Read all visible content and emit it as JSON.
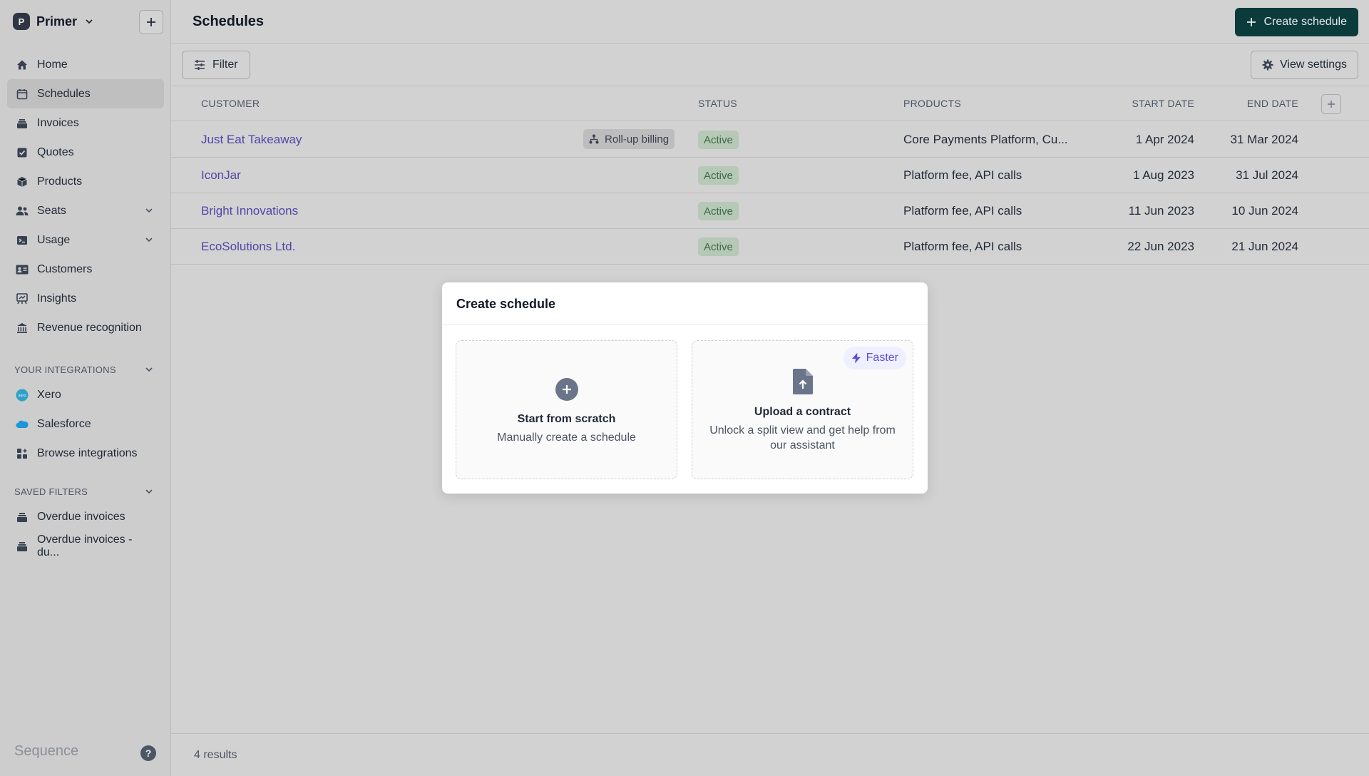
{
  "workspace": {
    "initial": "P",
    "name": "Primer"
  },
  "sidebar": {
    "items": [
      {
        "label": "Home"
      },
      {
        "label": "Schedules"
      },
      {
        "label": "Invoices"
      },
      {
        "label": "Quotes"
      },
      {
        "label": "Products"
      },
      {
        "label": "Seats"
      },
      {
        "label": "Usage"
      },
      {
        "label": "Customers"
      },
      {
        "label": "Insights"
      },
      {
        "label": "Revenue recognition"
      }
    ],
    "integrations_header": "YOUR INTEGRATIONS",
    "integrations": [
      {
        "label": "Xero"
      },
      {
        "label": "Salesforce"
      },
      {
        "label": "Browse integrations"
      }
    ],
    "filters_header": "SAVED FILTERS",
    "saved_filters": [
      {
        "label": "Overdue invoices"
      },
      {
        "label": "Overdue invoices - du..."
      }
    ],
    "brand": "Sequence",
    "help": "?"
  },
  "header": {
    "title": "Schedules",
    "create_label": "Create schedule"
  },
  "toolbar": {
    "filter_label": "Filter",
    "view_settings_label": "View settings"
  },
  "table": {
    "columns": [
      "CUSTOMER",
      "STATUS",
      "PRODUCTS",
      "START DATE",
      "END DATE"
    ],
    "rows": [
      {
        "customer": "Just Eat Takeaway",
        "tag": "Roll-up billing",
        "status": "Active",
        "products": "Core Payments Platform, Cu...",
        "start": "1 Apr 2024",
        "end": "31 Mar 2024"
      },
      {
        "customer": "IconJar",
        "status": "Active",
        "products": "Platform fee, API calls",
        "start": "1 Aug 2023",
        "end": "31 Jul 2024"
      },
      {
        "customer": "Bright Innovations",
        "status": "Active",
        "products": "Platform fee, API calls",
        "start": "11 Jun 2023",
        "end": "10 Jun 2024"
      },
      {
        "customer": "EcoSolutions Ltd.",
        "status": "Active",
        "products": "Platform fee, API calls",
        "start": "22 Jun 2023",
        "end": "21 Jun 2024"
      }
    ]
  },
  "footer": {
    "results": "4 results"
  },
  "modal": {
    "title": "Create schedule",
    "option_scratch": {
      "title": "Start from scratch",
      "subtitle": "Manually create a schedule"
    },
    "option_upload": {
      "title": "Upload a contract",
      "subtitle": "Unlock a split view and get help from our assistant",
      "badge": "Faster"
    }
  },
  "colors": {
    "accent": "#0c3b3c",
    "link": "#4f46a8",
    "status_bg": "#b6c8b6",
    "status_text": "#3f6a45",
    "badge": "#5b4fd6"
  }
}
